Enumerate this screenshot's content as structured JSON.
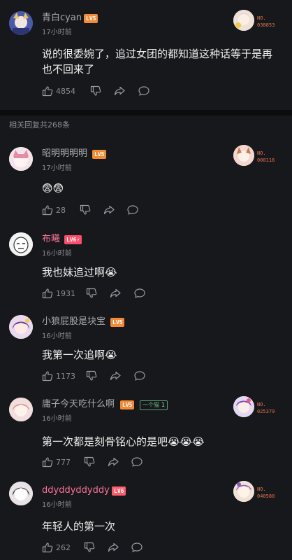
{
  "top_comment": {
    "username": "青白cyan",
    "level": "LV5",
    "time": "17小时前",
    "text": "说的很委婉了，追过女团的都知道这种话等于是再也不回来了",
    "likes": "4854",
    "badge_no": "NO.",
    "badge_num": "038853"
  },
  "replies_header": "相关回复共268条",
  "replies": [
    {
      "username": "昭明明明明",
      "level": "LV5",
      "time": "17小时前",
      "text": "😨😨",
      "likes": "28",
      "badge_no": "NO.",
      "badge_num": "000116"
    },
    {
      "username": "布曦",
      "level": "LV6⚡",
      "time": "16小时前",
      "text": "我也妹追过啊😭",
      "likes": "1931"
    },
    {
      "username": "小狼屁股是块宝",
      "level": "LV5",
      "time": "16小时前",
      "text": "我第一次追啊😭",
      "likes": "1173"
    },
    {
      "username": "庸子今天吃什么啊",
      "level": "LV5",
      "fan_medal": "一个猫",
      "fan_level": "1",
      "time": "16小时前",
      "text": "第一次都是刻骨铭心的是吧😭😭😭",
      "likes": "777",
      "badge_no": "NO.",
      "badge_num": "025379"
    },
    {
      "username": "ddyddyddyddy",
      "level": "LV6",
      "time": "16小时前",
      "text": "年轻人的第一次",
      "likes": "262",
      "badge_no": "NO.",
      "badge_num": "040580"
    }
  ],
  "icons": {
    "like": "thumbs-up-icon",
    "dislike": "thumbs-down-icon",
    "share": "share-icon",
    "reply": "reply-bubble-icon"
  },
  "colors": {
    "background": "#17181b",
    "vip_name": "#fb7299",
    "level_orange": "#f28a36"
  }
}
